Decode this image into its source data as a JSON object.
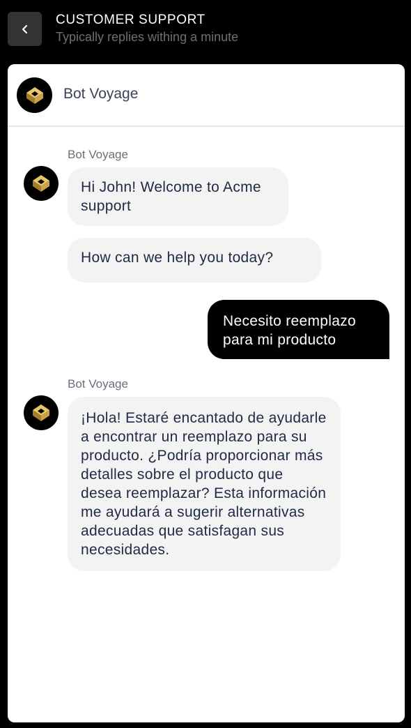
{
  "header": {
    "title": "CUSTOMER SUPPORT",
    "subtitle": "Typically replies withing a minute",
    "back_icon": "chevron-left-icon"
  },
  "bot": {
    "name": "Bot Voyage",
    "avatar_icon": "gold-cube-logo-icon"
  },
  "messages": [
    {
      "sender": "Bot Voyage",
      "from": "bot",
      "text": "Hi John! Welcome to Acme support"
    },
    {
      "from": "bot",
      "text": "How can we help you today?"
    },
    {
      "from": "user",
      "text": "Necesito reemplazo para mi producto"
    },
    {
      "sender": "Bot Voyage",
      "from": "bot",
      "text": "¡Hola! Estaré encantado de ayudarle a encontrar un reemplazo para su producto. ¿Podría proporcionar más detalles sobre el producto que desea reemplazar? Esta información me ayudará a sugerir alternativas adecuadas que satisfagan sus necesidades."
    }
  ],
  "colors": {
    "background": "#000000",
    "panel": "#ffffff",
    "bot_bubble": "#f3f3f4",
    "user_bubble": "#000000",
    "logo_gold": "#c9a24a"
  }
}
